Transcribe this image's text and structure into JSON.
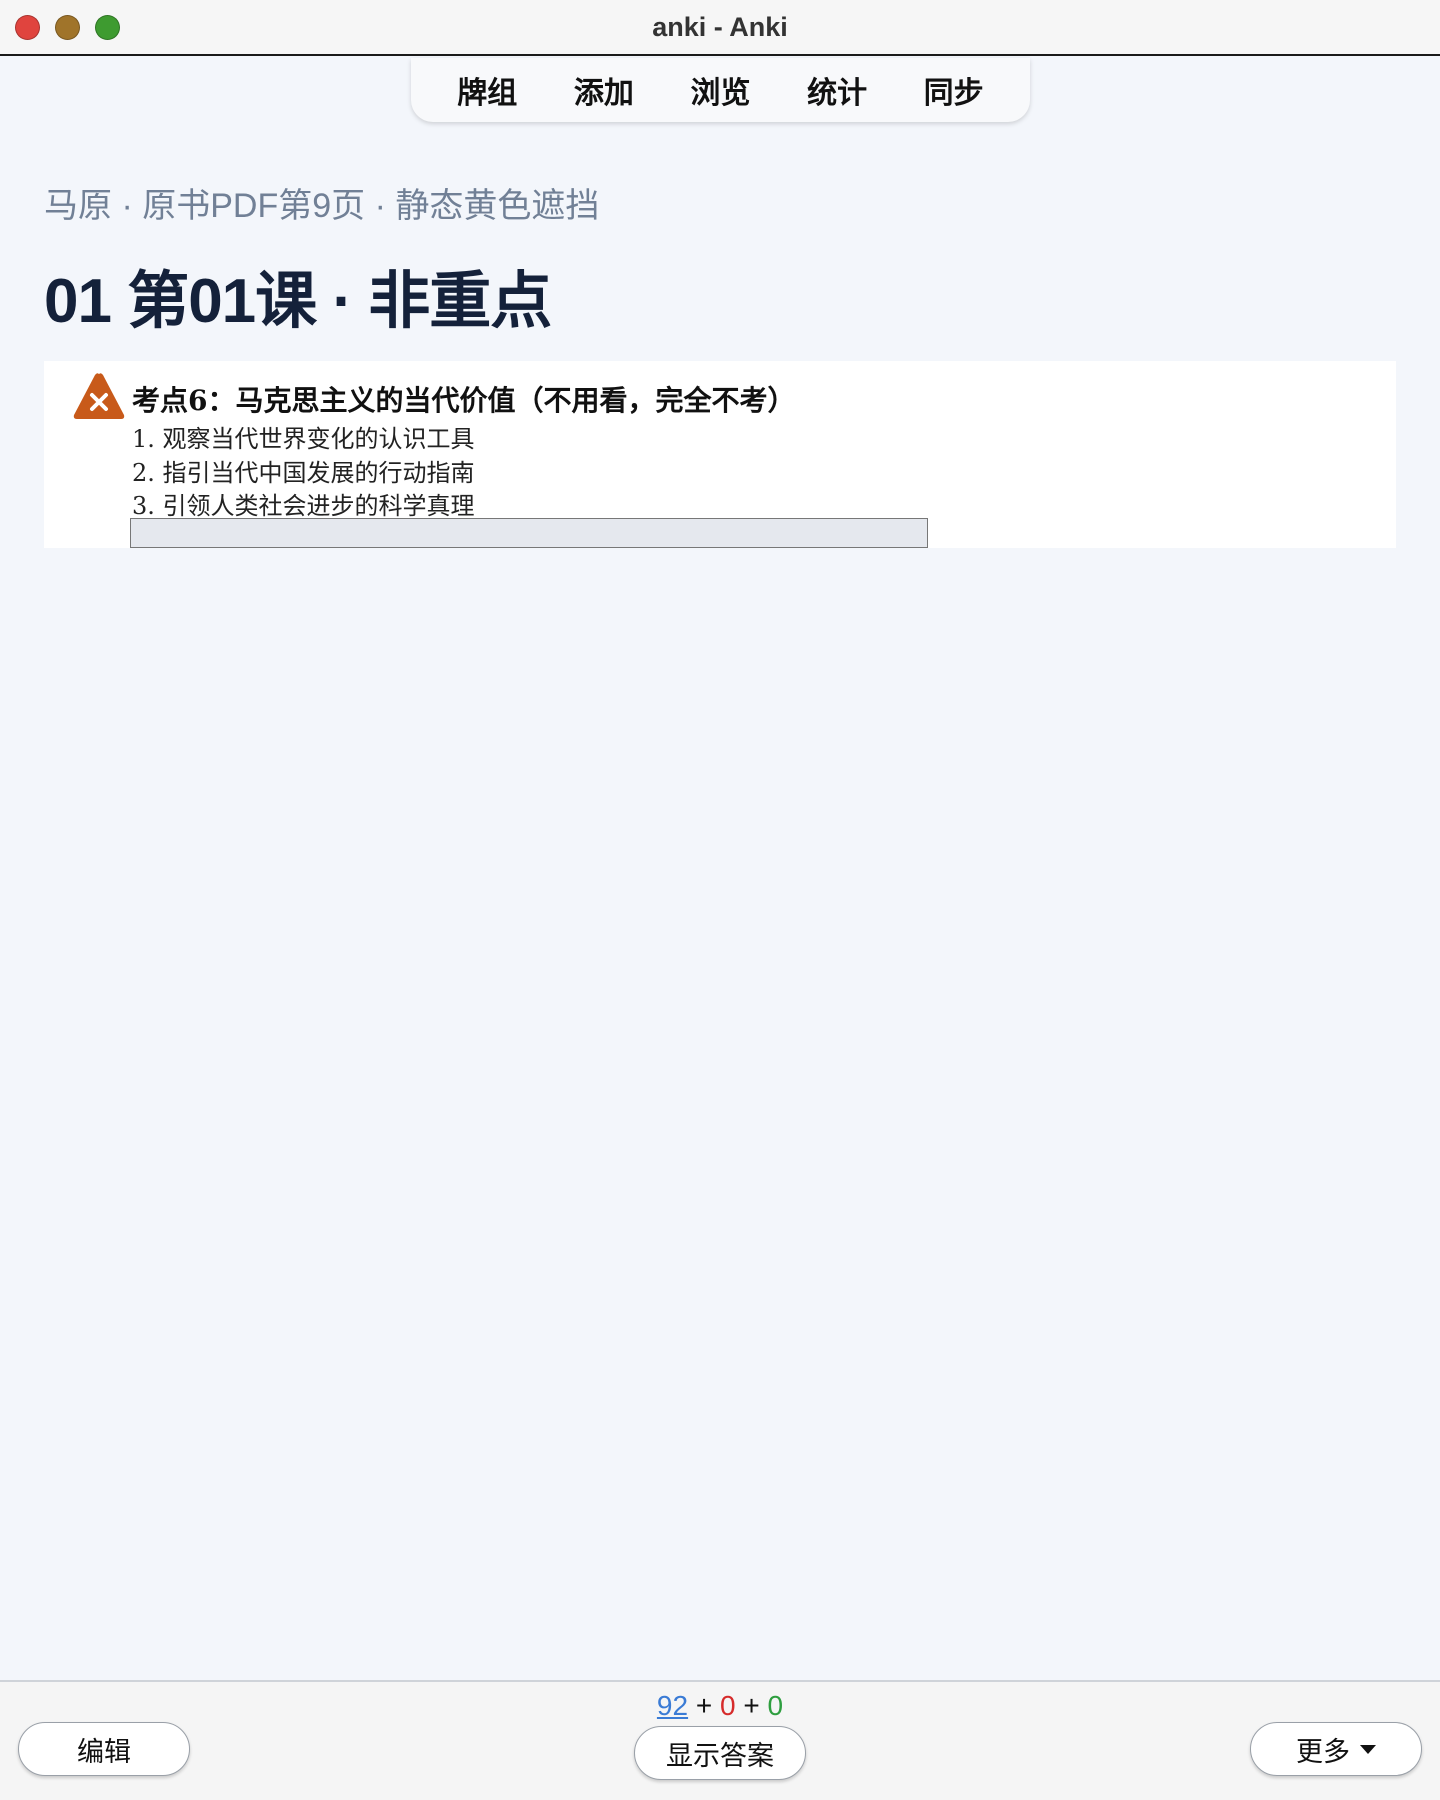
{
  "window": {
    "title": "anki - Anki"
  },
  "toolbar": {
    "items": [
      "牌组",
      "添加",
      "浏览",
      "统计",
      "同步"
    ]
  },
  "card": {
    "deck_path": "马原 · 原书PDF第9页 · 静态黄色遮挡",
    "title": "01 第01课 · 非重点",
    "heading": "考点6：马克思主义的当代价值（不用看，完全不考）",
    "items": [
      "1. 观察当代世界变化的认识工具",
      "2. 指引当代中国发展的行动指南",
      "3. 引领人类社会进步的科学真理"
    ]
  },
  "bottom": {
    "edit_label": "编辑",
    "show_answer_label": "显示答案",
    "more_label": "更多",
    "counts": {
      "new": "92",
      "learn": "0",
      "review": "0",
      "sep": "+"
    }
  },
  "colors": {
    "new": "#3a7bd5",
    "learn": "#d62b2b",
    "review": "#2e9e3f",
    "warning": "#c85a1a"
  }
}
